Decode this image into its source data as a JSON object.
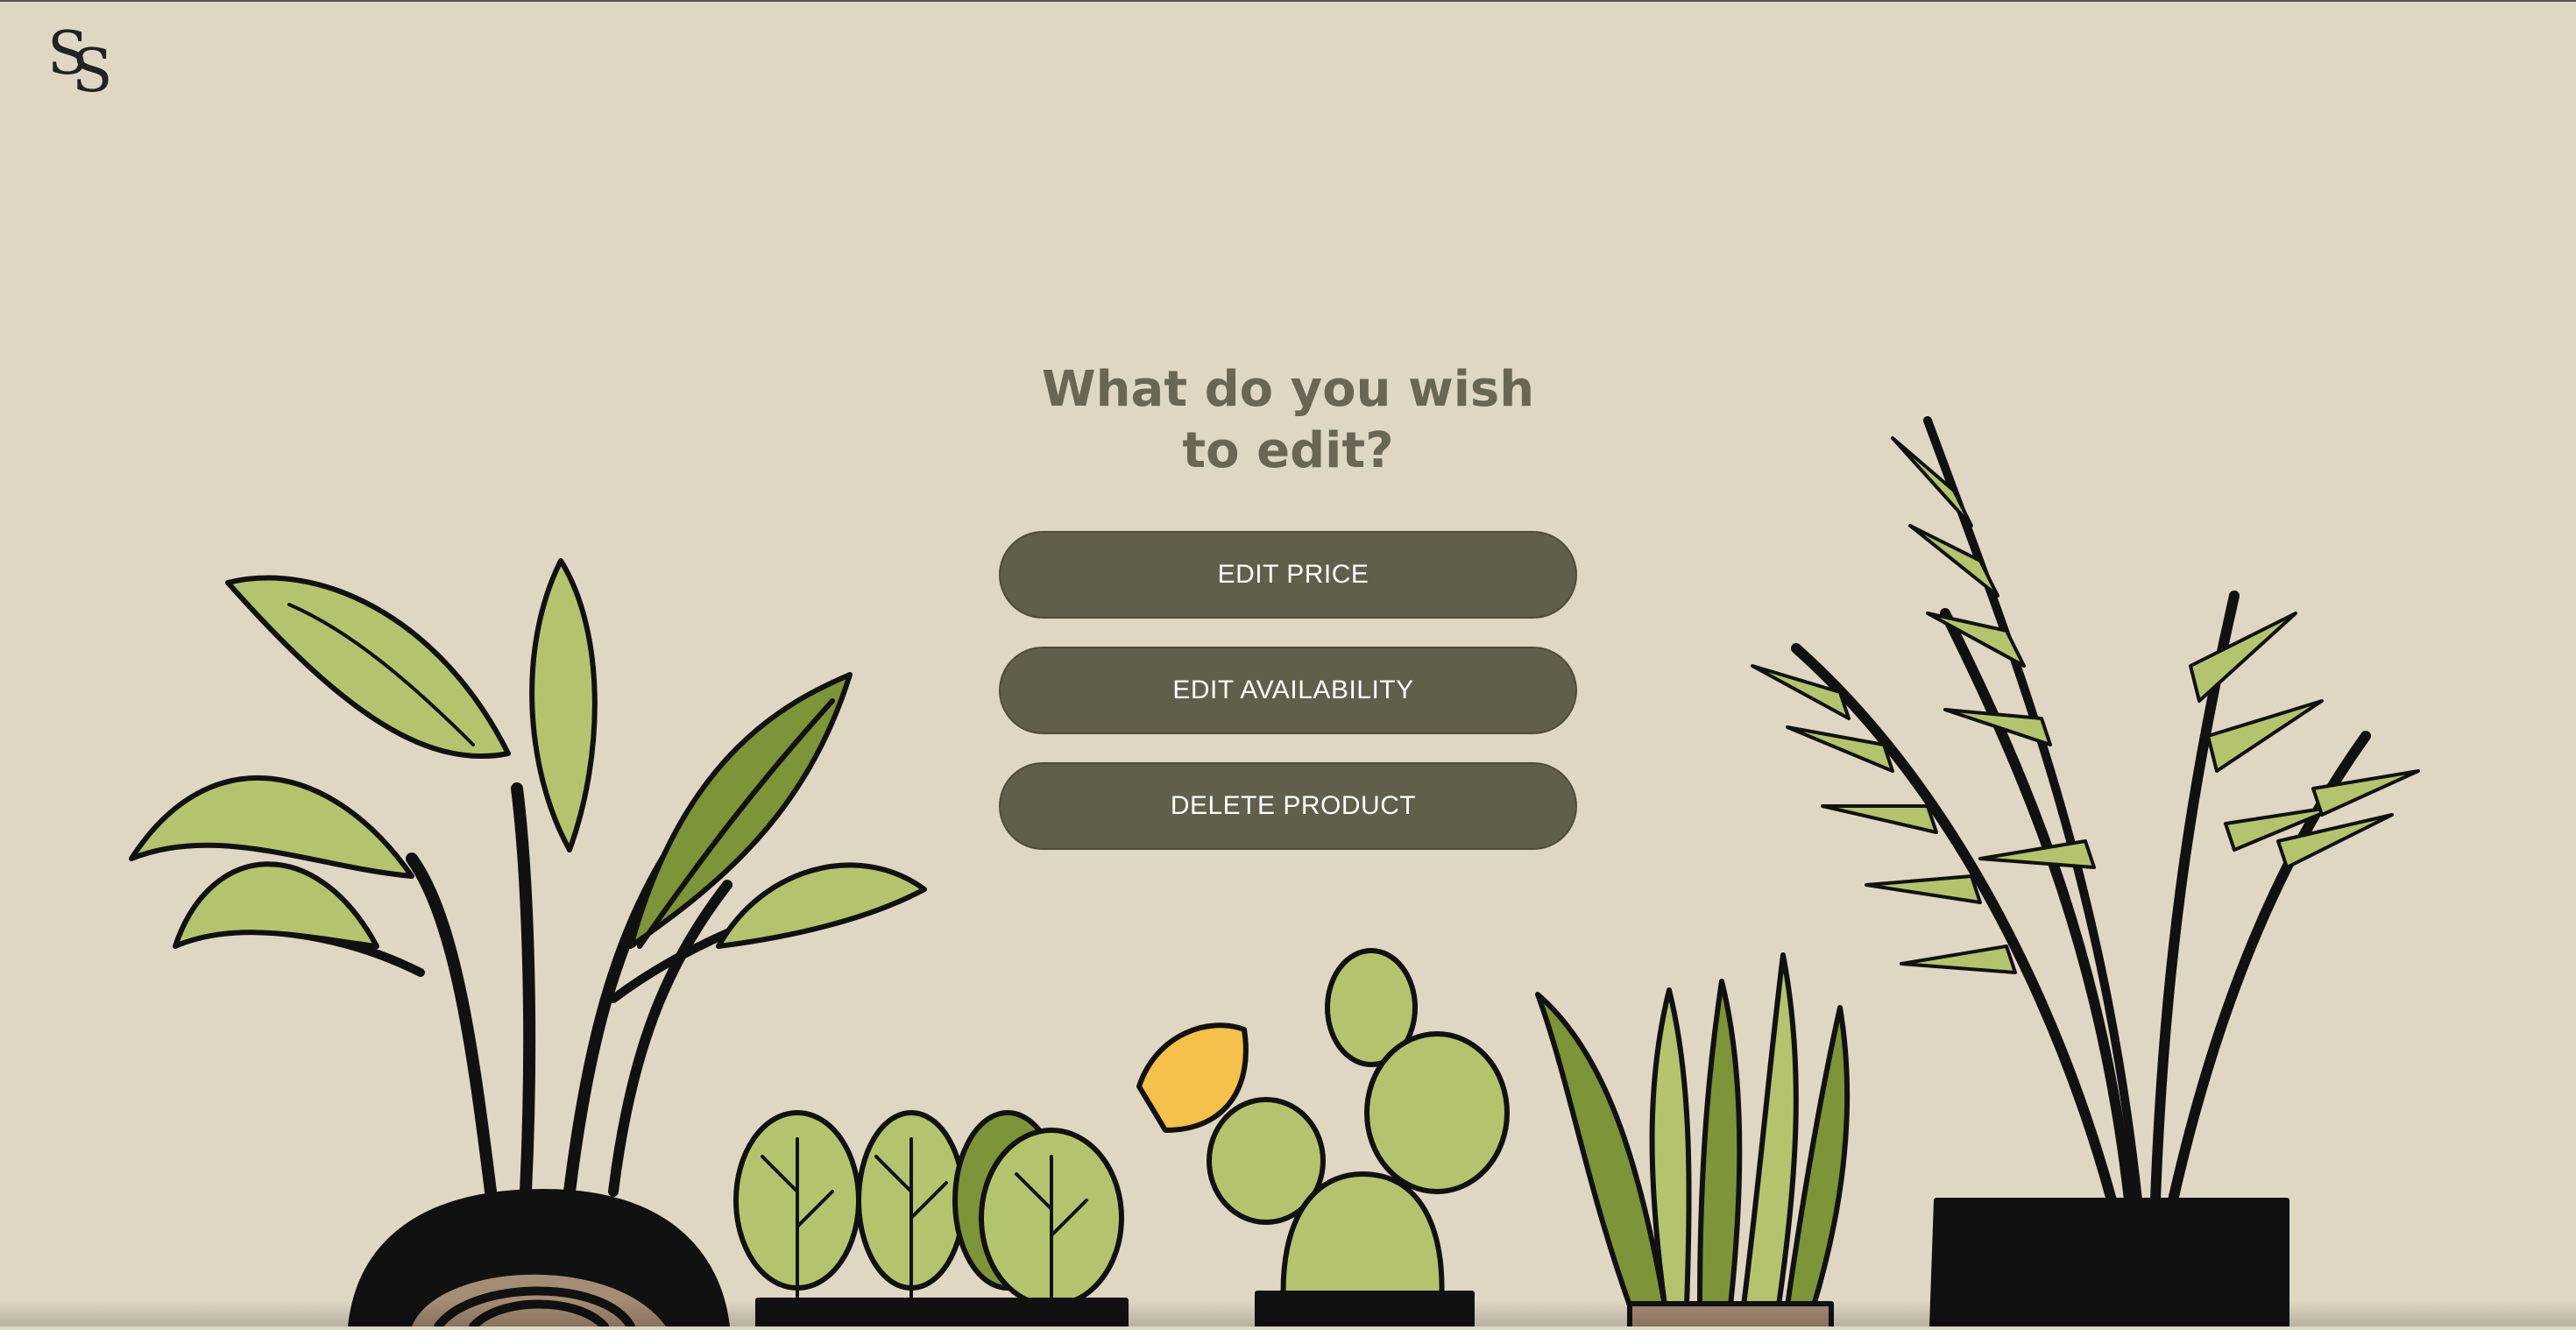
{
  "logo": {
    "text": "SS",
    "icon": "brand-monogram-icon"
  },
  "dialog": {
    "title": "What do you wish to edit?",
    "buttons": [
      {
        "label": "EDIT PRICE"
      },
      {
        "label": "EDIT AVAILABILITY"
      },
      {
        "label": "DELETE PRODUCT"
      }
    ]
  },
  "colors": {
    "background": "#e0d6c4",
    "button": "#615f4b",
    "title": "#6a6656",
    "leaf_light": "#b4c46e",
    "leaf_dark": "#7d9438",
    "outline": "#111111"
  }
}
